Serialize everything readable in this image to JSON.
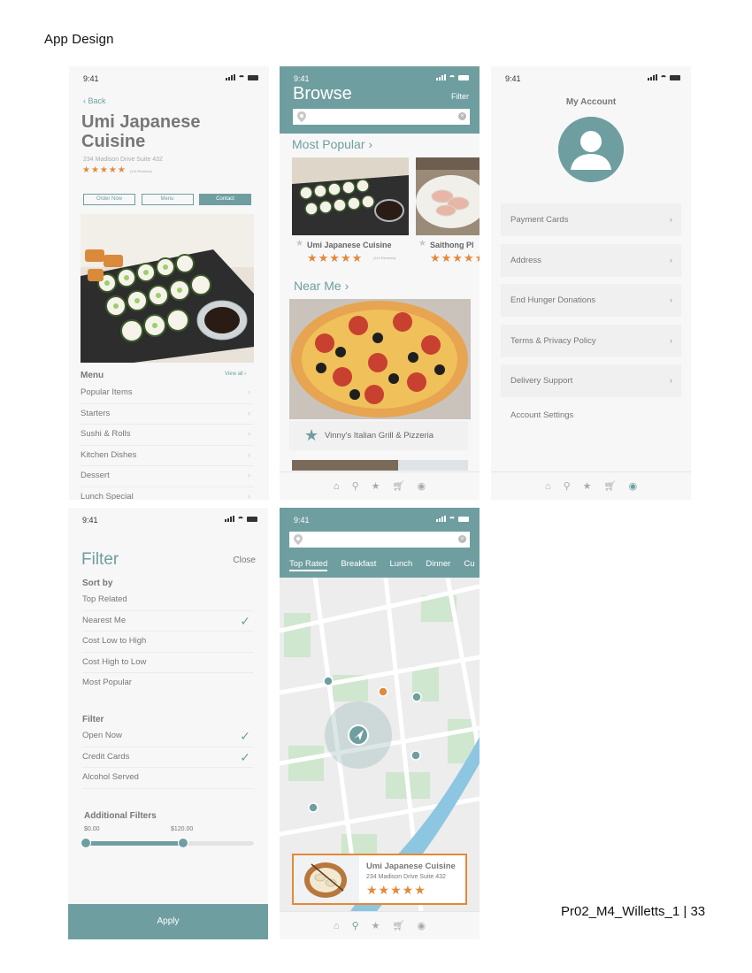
{
  "page": {
    "heading": "App Design",
    "footer": "Pr02_M4_Willetts_1 | 33"
  },
  "status_time": "9:41",
  "restaurant_screen": {
    "back": "Back",
    "title": "Umi Japanese Cuisine",
    "address": "234 Madison Drive Suite 432",
    "stars": "★★★★★",
    "review_count": "(114 Reviews)",
    "buttons": [
      "Order Now",
      "Menu",
      "Contact"
    ],
    "menu_heading": "Menu",
    "view_all": "View all ›",
    "menu_items": [
      "Popular Items",
      "Starters",
      "Sushi & Rolls",
      "Kitchen Dishes",
      "Dessert",
      "Lunch Special"
    ]
  },
  "browse_screen": {
    "title": "Browse",
    "filter": "Filter",
    "most_popular": "Most Popular ›",
    "card1_name": "Umi Japanese Cuisine",
    "card1_reviews": "(114 Reviews)",
    "card2_name": "Saithong Pl",
    "stars": "★★★★★",
    "near_me": "Near Me ›",
    "near_me_name": "Vinny's Italian Grill & Pizzeria",
    "tabs": [
      "home-icon",
      "location-icon",
      "star-icon",
      "cart-icon",
      "account-icon"
    ]
  },
  "account_screen": {
    "title": "My Account",
    "rows": [
      "Payment Cards",
      "Address",
      "End Hunger Donations",
      "Terms & Privacy Policy",
      "Delivery Support"
    ],
    "settings": "Account Settings",
    "active_tab": "account"
  },
  "filter_screen": {
    "title": "Filter",
    "close": "Close",
    "sort_heading": "Sort by",
    "sort_options": [
      {
        "label": "Top Related",
        "checked": false
      },
      {
        "label": "Nearest Me",
        "checked": true
      },
      {
        "label": "Cost Low to High",
        "checked": false
      },
      {
        "label": "Cost High to Low",
        "checked": false
      },
      {
        "label": "Most Popular",
        "checked": false
      }
    ],
    "filter_heading": "Filter",
    "filter_options": [
      {
        "label": "Open Now",
        "checked": true
      },
      {
        "label": "Credit Cards",
        "checked": true
      },
      {
        "label": "Alcohol Served",
        "checked": false
      }
    ],
    "additional_heading": "Additional Filters",
    "price_min": "$0.00",
    "price_max": "$120.00",
    "range_fraction": 0.58,
    "apply": "Apply"
  },
  "map_screen": {
    "categories": [
      "Top Rated",
      "Breakfast",
      "Lunch",
      "Dinner",
      "Cu"
    ],
    "selected_category": "Top Rated",
    "card_name": "Umi Japanese Cuisine",
    "card_address": "234 Madison Drive Suite 432",
    "stars": "★★★★★",
    "active_tab": "location"
  },
  "colors": {
    "teal": "#6f9ea0",
    "orange": "#e3893a"
  }
}
